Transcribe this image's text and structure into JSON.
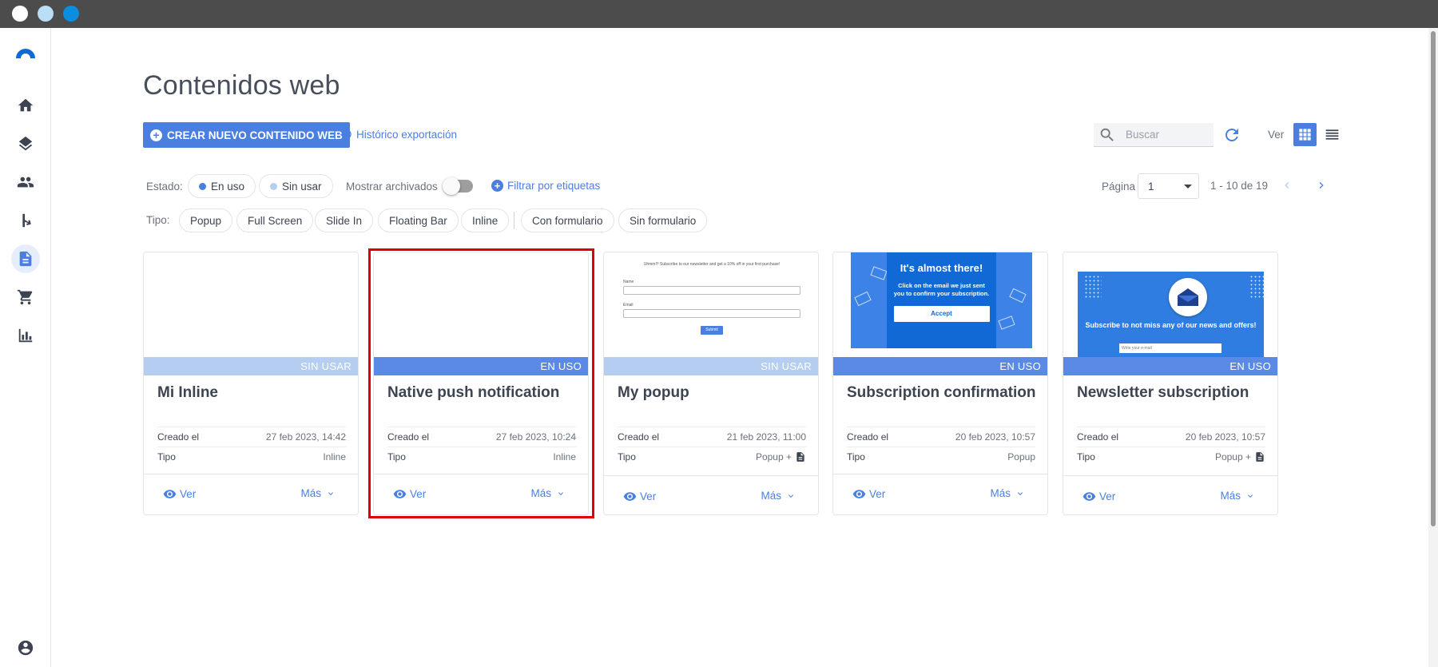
{
  "page": {
    "title": "Contenidos web"
  },
  "toolbar": {
    "create_label": "CREAR NUEVO CONTENIDO WEB",
    "history_label": "Histórico exportación",
    "search_placeholder": "Buscar",
    "view_label": "Ver"
  },
  "filters": {
    "estado_label": "Estado:",
    "en_uso": "En uso",
    "sin_usar": "Sin usar",
    "archivados_label": "Mostrar archivados",
    "tags_label": "Filtrar por etiquetas",
    "tipo_label": "Tipo:",
    "types": [
      "Popup",
      "Full Screen",
      "Slide In",
      "Floating Bar",
      "Inline"
    ],
    "form_types": [
      "Con formulario",
      "Sin formulario"
    ],
    "colors": {
      "en_uso_dot": "#4a7fe0",
      "sin_usar_dot": "#b6cdf2"
    }
  },
  "pagination": {
    "label": "Página",
    "current": "1",
    "range": "1 - 10 de 19"
  },
  "cards": [
    {
      "status": "SIN USAR",
      "title": "Mi Inline",
      "created_label": "Creado el",
      "created": "27 feb 2023, 14:42",
      "type_label": "Tipo",
      "type": "Inline",
      "ver": "Ver",
      "mas": "Más"
    },
    {
      "status": "EN USO",
      "title": "Native push notification",
      "created_label": "Creado el",
      "created": "27 feb 2023, 10:24",
      "type_label": "Tipo",
      "type": "Inline",
      "ver": "Ver",
      "mas": "Más"
    },
    {
      "status": "SIN USAR",
      "title": "My popup",
      "created_label": "Creado el",
      "created": "21 feb 2023, 11:00",
      "type_label": "Tipo",
      "type": "Popup +",
      "ver": "Ver",
      "mas": "Más",
      "preview": {
        "header": "Uhmm!!! Subscribe to our newsletter and get a 10% off in your first purchase!",
        "name_label": "Name",
        "email_label": "Email",
        "submit": "Submit"
      }
    },
    {
      "status": "EN USO",
      "title": "Subscription confirmation",
      "created_label": "Creado el",
      "created": "20 feb 2023, 10:57",
      "type_label": "Tipo",
      "type": "Popup",
      "ver": "Ver",
      "mas": "Más",
      "preview": {
        "heading": "It's almost there!",
        "text": "Click on the email we just sent you to confirm your subscription.",
        "button": "Accept"
      }
    },
    {
      "status": "EN USO",
      "title": "Newsletter subscription",
      "created_label": "Creado el",
      "created": "20 feb 2023, 10:57",
      "type_label": "Tipo",
      "type": "Popup +",
      "ver": "Ver",
      "mas": "Más",
      "preview": {
        "text": "Subscribe to not miss any of our news and offers!",
        "input_placeholder": "Write your e-mail"
      }
    }
  ],
  "icons": {
    "sidebar": [
      "logo-icon",
      "home-icon",
      "layers-icon",
      "people-icon",
      "flow-icon",
      "document-icon",
      "cart-icon",
      "chart-icon",
      "account-icon"
    ]
  }
}
